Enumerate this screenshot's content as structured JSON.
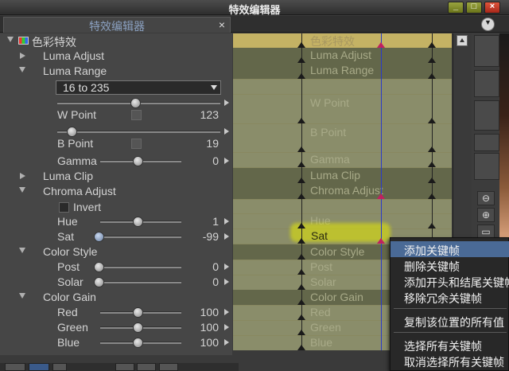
{
  "window": {
    "title": "特效编辑器"
  },
  "tab": {
    "label": "特效编辑器",
    "close": "×"
  },
  "tab_menu": {
    "glyph": "▼"
  },
  "params": {
    "effect": "色彩特效",
    "luma_adjust": "Luma Adjust",
    "luma_range": "Luma Range",
    "range_select": "16 to 235",
    "w_point": {
      "label": "W Point",
      "value": "123"
    },
    "b_point": {
      "label": "B Point",
      "value": "19"
    },
    "gamma": {
      "label": "Gamma",
      "value": "0"
    },
    "luma_clip": "Luma Clip",
    "chroma_adjust": "Chroma Adjust",
    "invert": "Invert",
    "hue": {
      "label": "Hue",
      "value": "1"
    },
    "sat": {
      "label": "Sat",
      "value": "-99"
    },
    "color_style": "Color Style",
    "post": {
      "label": "Post",
      "value": "0"
    },
    "solar": {
      "label": "Solar",
      "value": "0"
    },
    "color_gain": "Color Gain",
    "red": {
      "label": "Red",
      "value": "100"
    },
    "green": {
      "label": "Green",
      "value": "100"
    },
    "blue": {
      "label": "Blue",
      "value": "100"
    }
  },
  "timeline_labels": {
    "effect": "色彩特效",
    "luma_adjust": "Luma Adjust",
    "luma_range": "Luma Range",
    "w_point": "W Point",
    "b_point": "B Point",
    "gamma": "Gamma",
    "luma_clip": "Luma Clip",
    "chroma_adjust": "Chroma Adjust",
    "hue": "Hue",
    "sat": "Sat",
    "color_style": "Color Style",
    "post": "Post",
    "solar": "Solar",
    "color_gain": "Color Gain",
    "red": "Red",
    "green": "Green",
    "blue": "Blue"
  },
  "context_menu": [
    "添加关键帧",
    "删除关键帧",
    "添加开头和结尾关键帧",
    "移除冗余关键帧",
    "复制该位置的所有值",
    "选择所有关键帧",
    "取消选择所有关键帧"
  ],
  "window_buttons": {
    "min": "_",
    "max": "□",
    "close": "×"
  },
  "tools": {
    "zoom_out": "⊖",
    "zoom_in": "⊕",
    "fit": "▭"
  },
  "colors": {
    "highlight": "#e6eb00",
    "playhead": "#2a3ac8",
    "menu_hover": "#4a6a96"
  }
}
